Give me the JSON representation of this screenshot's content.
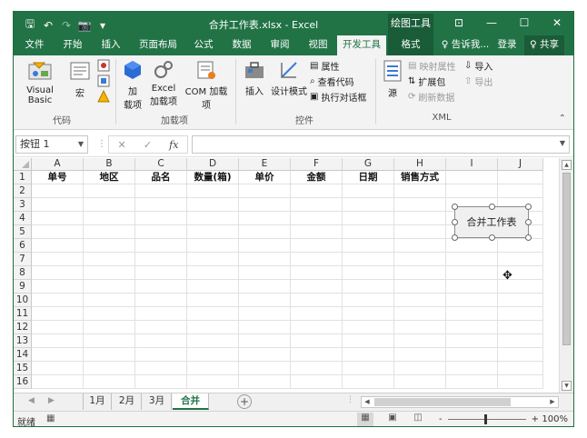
{
  "window": {
    "title": "合并工作表.xlsx - Excel",
    "context_group": "绘图工具",
    "controls": {
      "ribbon_display": "⊡",
      "minimize": "—",
      "maximize": "☐",
      "close": "✕"
    }
  },
  "qat": {
    "save": "🖫",
    "undo": "↶",
    "redo": "↷",
    "camera": "📷",
    "customize": "▾"
  },
  "tabs": [
    {
      "label": "文件"
    },
    {
      "label": "开始"
    },
    {
      "label": "插入"
    },
    {
      "label": "页面布局"
    },
    {
      "label": "公式"
    },
    {
      "label": "数据"
    },
    {
      "label": "审阅"
    },
    {
      "label": "视图"
    },
    {
      "label": "开发工具"
    },
    {
      "label": "格式"
    }
  ],
  "tell_me": "♀ 告诉我...",
  "signin": "登录",
  "share": "♀ 共享",
  "ribbon": {
    "code": {
      "group_label": "代码",
      "visual_basic": "Visual Basic",
      "macros": "宏"
    },
    "addins": {
      "group_label": "加载项",
      "addins_line1": "加",
      "addins_line2": "载项",
      "excel_addins_line1": "Excel",
      "excel_addins_line2": "加载项",
      "com_addins": "COM 加载项"
    },
    "controls": {
      "group_label": "控件",
      "insert": "插入",
      "design_mode": "设计模式",
      "properties": "属性",
      "view_code": "查看代码",
      "run_dialog": "执行对话框"
    },
    "xml": {
      "group_label": "XML",
      "source": "源",
      "map_properties": "映射属性",
      "expansion_packs": "扩展包",
      "refresh_data": "刷新数据",
      "import": "导入",
      "export": "导出"
    }
  },
  "formula_bar": {
    "name_box": "按钮 1",
    "cancel": "✕",
    "enter": "✓",
    "fx": "fx",
    "value": ""
  },
  "grid": {
    "columns": [
      "A",
      "B",
      "C",
      "D",
      "E",
      "F",
      "G",
      "H",
      "I",
      "J"
    ],
    "rows": [
      "1",
      "2",
      "3",
      "4",
      "5",
      "6",
      "7",
      "8",
      "9",
      "10",
      "11",
      "12",
      "13",
      "14",
      "15",
      "16"
    ],
    "headers_row1": [
      "单号",
      "地区",
      "品名",
      "数量(箱)",
      "单价",
      "金额",
      "日期",
      "销售方式",
      "",
      ""
    ]
  },
  "shape_button": {
    "label": "合并工作表"
  },
  "sheets": [
    {
      "label": "1月"
    },
    {
      "label": "2月"
    },
    {
      "label": "3月"
    },
    {
      "label": "合并"
    }
  ],
  "status": {
    "ready": "就绪",
    "zoom": "100%",
    "zoom_minus": "-",
    "zoom_plus": "+"
  }
}
